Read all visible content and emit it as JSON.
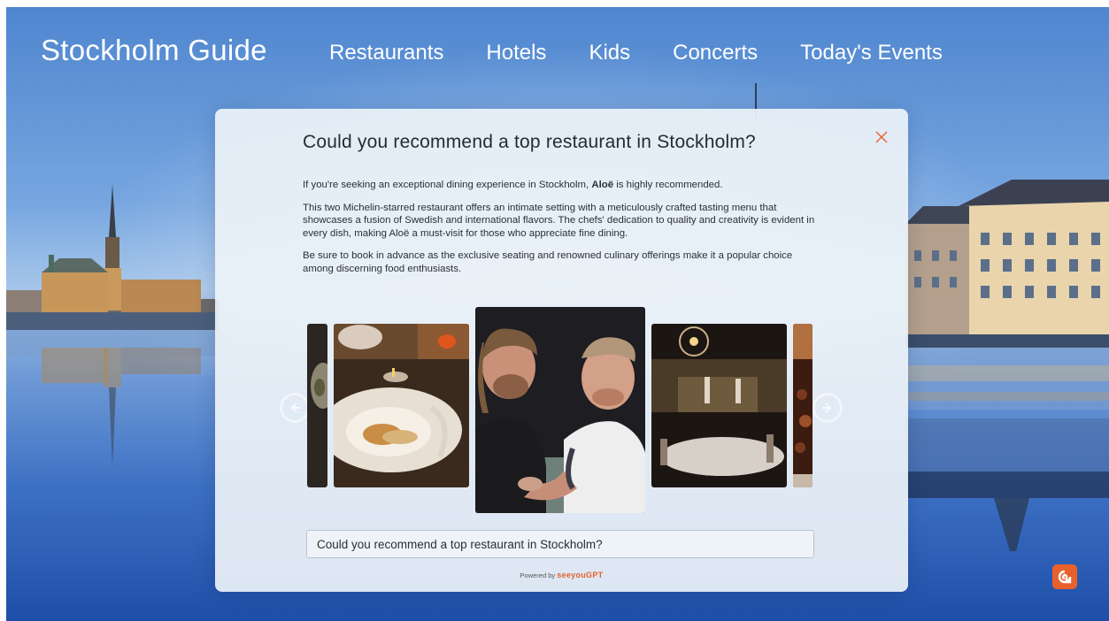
{
  "header": {
    "brand": "Stockholm Guide",
    "nav": [
      "Restaurants",
      "Hotels",
      "Kids",
      "Concerts",
      "Today's Events"
    ]
  },
  "modal": {
    "title": "Could you recommend a top restaurant in Stockholm?",
    "answer": {
      "intro_prefix": "If you're seeking an exceptional dining experience in Stockholm, ",
      "restaurant": "Aloë",
      "intro_suffix": " is highly recommended.",
      "paragraph2": "This two Michelin-starred restaurant offers an intimate setting with a meticulously crafted tasting menu that showcases a fusion of Swedish and international flavors. The chefs' dedication to quality and creativity is evident in every dish, making Aloë a must-visit for those who appreciate fine dining.",
      "paragraph3": "Be sure to book in advance as the exclusive seating and renowned culinary offerings make it a popular choice among discerning food enthusiasts."
    },
    "input": {
      "value": "Could you recommend a top restaurant in Stockholm?"
    },
    "powered_by": "Powered by",
    "powered_brand": "seeyouGPT"
  },
  "colors": {
    "accent": "#e8612c",
    "modal_bg": "#ecf2f8"
  },
  "icons": {
    "close": "close-icon",
    "prev": "arrow-left-icon",
    "next": "arrow-right-icon",
    "fab": "chat-logo-icon"
  }
}
